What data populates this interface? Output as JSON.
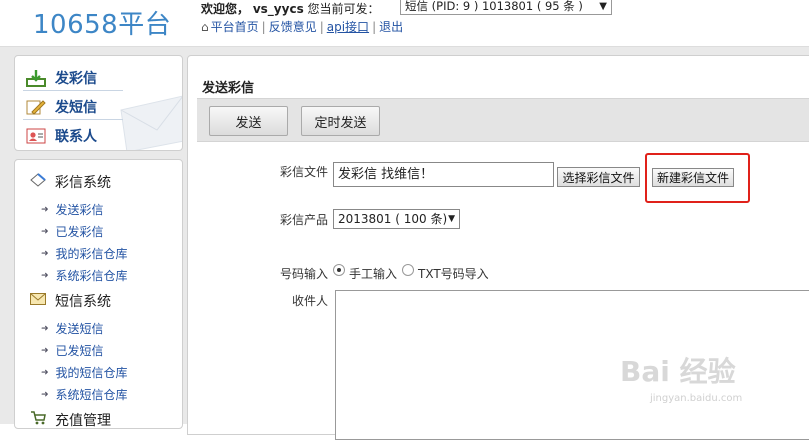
{
  "header": {
    "logo": "10658平台",
    "welcome_prefix": "欢迎您，",
    "username": "vs_yycs",
    "welcome_suffix": "您当前可发：",
    "account_select": "短信 (PID: 9 ) 1013801 ( 95 条 )",
    "nav": {
      "home": "平台首页",
      "feedback": "反馈意见",
      "api": "api接口",
      "logout": "退出"
    }
  },
  "sidebar": {
    "quick": [
      {
        "label": "发彩信",
        "icon": "download-icon"
      },
      {
        "label": "发短信",
        "icon": "pencil-icon"
      },
      {
        "label": "联系人",
        "icon": "contact-card-icon"
      }
    ],
    "groups": {
      "mms": {
        "title": "彩信系统",
        "icon": "mms-diamond-icon",
        "items": [
          "发送彩信",
          "已发彩信",
          "我的彩信仓库",
          "系统彩信仓库"
        ]
      },
      "sms": {
        "title": "短信系统",
        "icon": "envelope-icon",
        "items": [
          "发送短信",
          "已发短信",
          "我的短信仓库",
          "系统短信仓库"
        ]
      },
      "recharge": {
        "title": "充值管理",
        "icon": "cart-icon"
      }
    }
  },
  "main": {
    "title": "发送彩信",
    "toolbar": {
      "send": "发送",
      "schedule": "定时发送"
    },
    "form": {
      "file_label": "彩信文件",
      "file_value": "发彩信 找维信！",
      "choose_button": "选择彩信文件",
      "new_button": "新建彩信文件",
      "product_label": "彩信产品",
      "product_value": "2013801 ( 100 条)",
      "number_label": "号码输入",
      "manual_label": "手工输入",
      "txt_label": "TXT号码导入",
      "recipient_label": "收件人"
    }
  },
  "watermark": {
    "brand": "Bai 经验",
    "url": "jingyan.baidu.com"
  },
  "colors": {
    "logo": "#3d86c6",
    "link": "#2353a3",
    "highlight": "#e0211a"
  }
}
